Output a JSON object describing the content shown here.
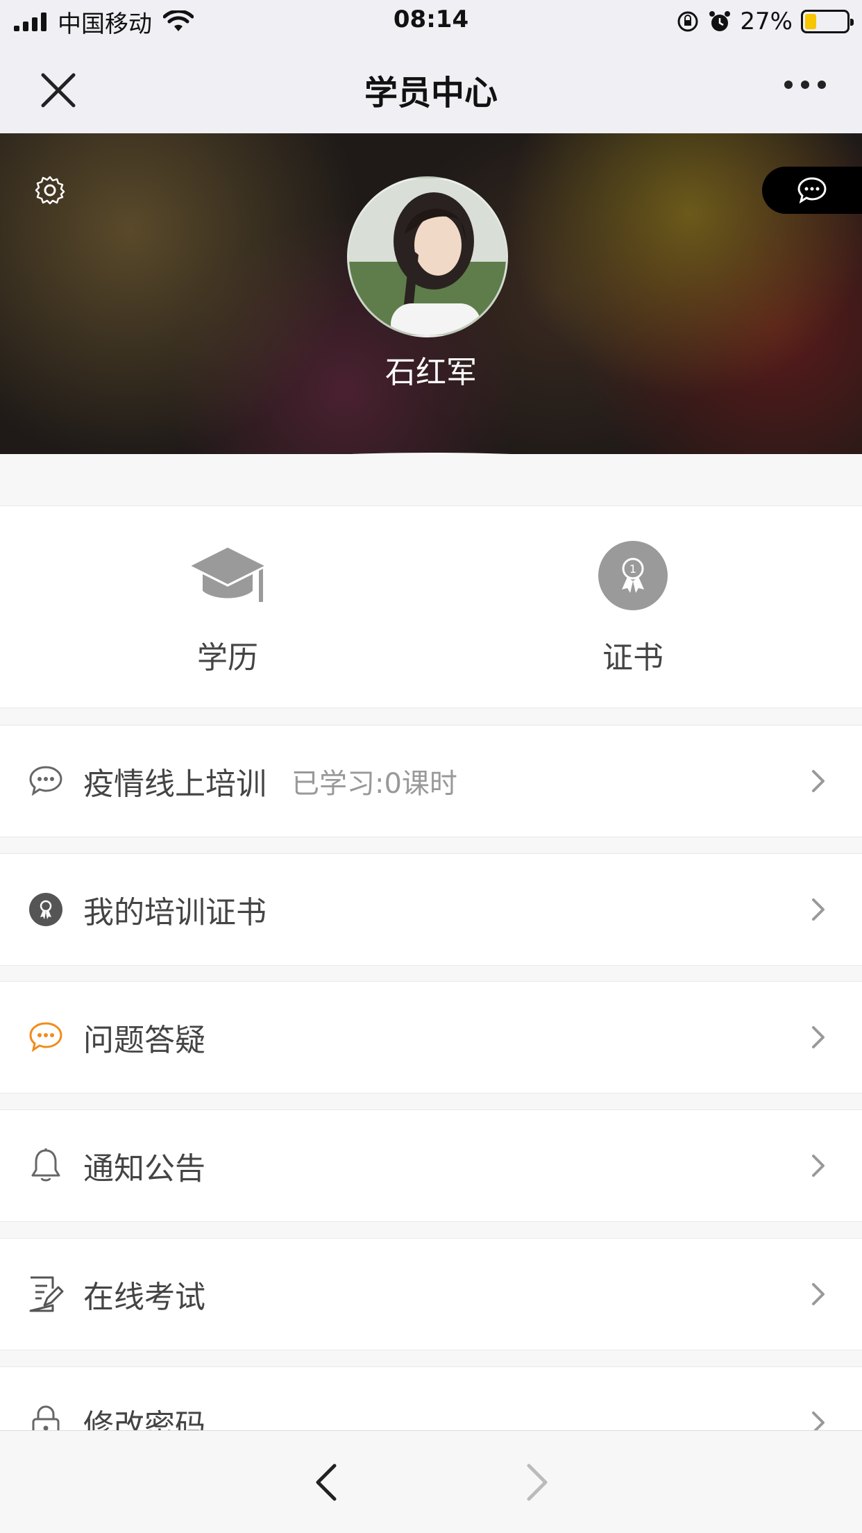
{
  "status_bar": {
    "carrier": "中国移动",
    "time": "08:14",
    "battery_percent": "27%",
    "battery_level": 0.27
  },
  "nav": {
    "title": "学员中心",
    "close_icon": "close-icon",
    "more_icon": "more-icon"
  },
  "profile": {
    "name": "石红军",
    "settings_icon": "gear-icon",
    "message_icon": "chat-bubble-icon"
  },
  "quick_tiles": [
    {
      "label": "学历",
      "icon": "graduation-cap-icon"
    },
    {
      "label": "证书",
      "icon": "certificate-badge-icon"
    }
  ],
  "menu": [
    {
      "label": "疫情线上培训",
      "sub": "已学习:0课时",
      "icon": "chat-bubble-icon"
    },
    {
      "label": "我的培训证书",
      "sub": "",
      "icon": "certificate-badge-icon"
    },
    {
      "label": "问题答疑",
      "sub": "",
      "icon": "chat-bubble-icon",
      "icon_color": "#f08c1a"
    },
    {
      "label": "通知公告",
      "sub": "",
      "icon": "bell-icon"
    },
    {
      "label": "在线考试",
      "sub": "",
      "icon": "exam-paper-icon"
    },
    {
      "label": "修改密码",
      "sub": "",
      "icon": "lock-icon"
    }
  ],
  "colors": {
    "accent_orange": "#f08c1a",
    "icon_gray": "#666666",
    "tile_gray": "#9a9a9a"
  }
}
